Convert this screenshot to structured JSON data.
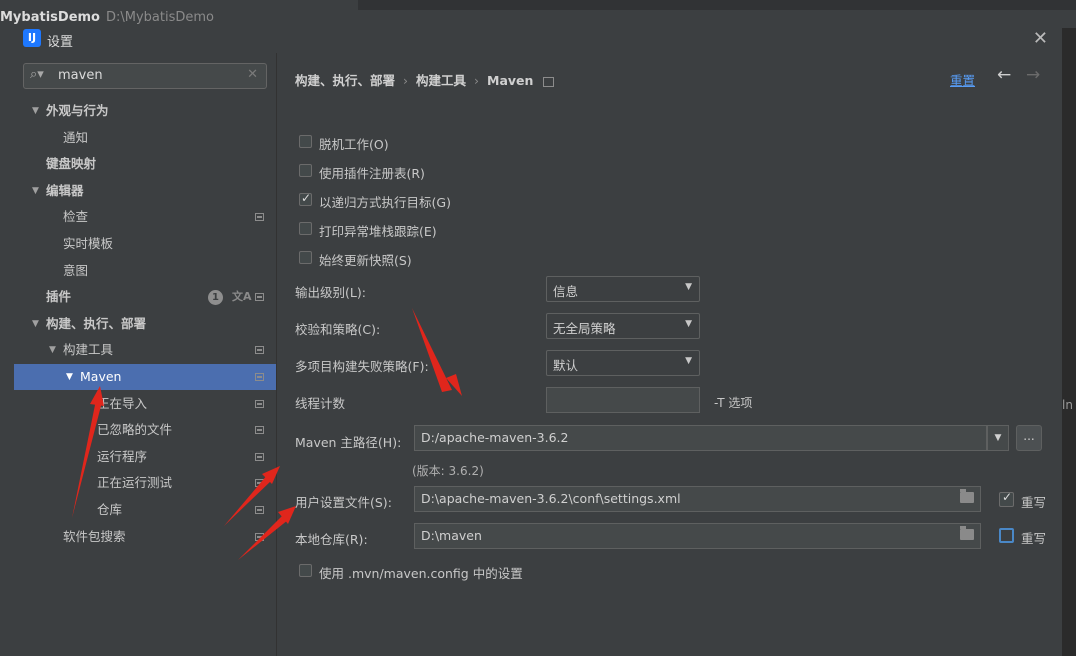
{
  "ide": {
    "project": "MybatisDemo",
    "project_path": "D:\\MybatisDemo"
  },
  "dialog": {
    "title": "设置",
    "logo_text": "IJ",
    "close_icon": "✕"
  },
  "search": {
    "value": "maven"
  },
  "tree": [
    {
      "label": "外观与行为",
      "bold": true,
      "arrow": "∨"
    },
    {
      "label": "通知"
    },
    {
      "label": "键盘映射",
      "bold": true
    },
    {
      "label": "编辑器",
      "bold": true,
      "arrow": "∨"
    },
    {
      "label": "检查"
    },
    {
      "label": "实时模板"
    },
    {
      "label": "意图"
    },
    {
      "label": "插件",
      "bold": true,
      "badge": "1"
    },
    {
      "label": "构建、执行、部署",
      "bold": true,
      "arrow": "∨"
    },
    {
      "label": "构建工具",
      "arrow": "∨"
    },
    {
      "label": "Maven",
      "arrow": "∨",
      "selected": true
    },
    {
      "label": "正在导入"
    },
    {
      "label": "已忽略的文件"
    },
    {
      "label": "运行程序"
    },
    {
      "label": "正在运行测试"
    },
    {
      "label": "仓库"
    },
    {
      "label": "软件包搜索"
    }
  ],
  "breadcrumb": {
    "part1": "构建、执行、部署",
    "part2": "构建工具",
    "part3": "Maven"
  },
  "header": {
    "reset": "重置"
  },
  "checkboxes": [
    {
      "label": "脱机工作(O)",
      "checked": false
    },
    {
      "label": "使用插件注册表(R)",
      "checked": false
    },
    {
      "label": "以递归方式执行目标(G)",
      "checked": true
    },
    {
      "label": "打印异常堆栈跟踪(E)",
      "checked": false
    },
    {
      "label": "始终更新快照(S)",
      "checked": false
    }
  ],
  "fields": {
    "output_level_label": "输出级别(L):",
    "output_level_value": "信息",
    "checksum_label": "校验和策略(C):",
    "checksum_value": "无全局策略",
    "multiproject_label": "多项目构建失败策略(F):",
    "multiproject_value": "默认",
    "thread_label": "线程计数",
    "thread_value": "",
    "thread_suffix": "-T 选项",
    "maven_home_label": "Maven 主路径(H):",
    "maven_home_value": "D:/apache-maven-3.6.2",
    "version": "(版本: 3.6.2)",
    "user_settings_label": "用户设置文件(S):",
    "user_settings_value": "D:\\apache-maven-3.6.2\\conf\\settings.xml",
    "override_label": "重写",
    "local_repo_label": "本地仓库(R):",
    "local_repo_value": "D:\\maven",
    "override2_label": "重写",
    "mvn_config_label": "使用 .mvn/maven.config 中的设置",
    "more_button": "...",
    "right_edge_text": "ln"
  },
  "colors": {
    "selection": "#4b6eaf",
    "link": "#589df6",
    "annotation": "#e0261c"
  }
}
